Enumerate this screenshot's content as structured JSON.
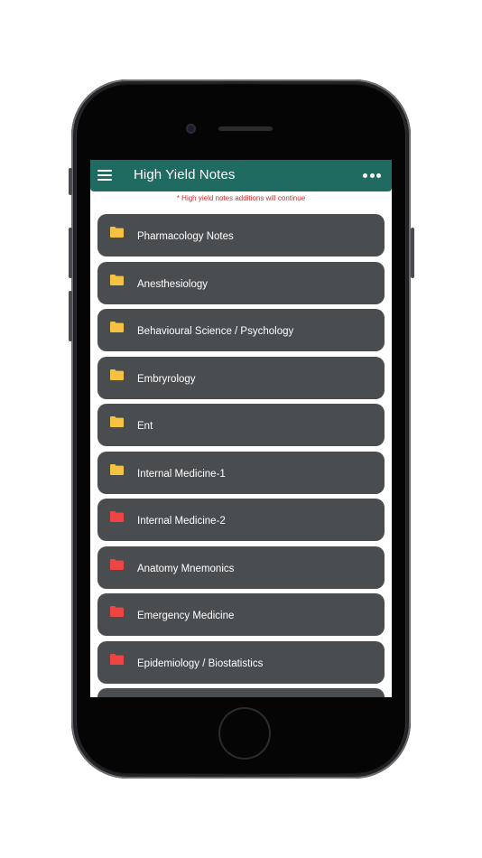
{
  "appbar": {
    "title": "High Yield Notes",
    "menu_icon": "hamburger-menu-icon",
    "more_icon": "more-options-icon",
    "background": "#1f6b62"
  },
  "notice": "* High yield notes additions will continue",
  "colors": {
    "notice": "#d92b2b",
    "item_background": "#4a4d50",
    "folder_yellow": "#f5c242",
    "folder_red": "#ef4444"
  },
  "items": [
    {
      "label": "Pharmacology Notes",
      "icon": "folder-icon",
      "color": "#f5c242"
    },
    {
      "label": "Anesthesiology",
      "icon": "folder-icon",
      "color": "#f5c242"
    },
    {
      "label": "Behavioural Science / Psychology",
      "icon": "folder-icon",
      "color": "#f5c242"
    },
    {
      "label": "Embryrology",
      "icon": "folder-icon",
      "color": "#f5c242"
    },
    {
      "label": "Ent",
      "icon": "folder-icon",
      "color": "#f5c242"
    },
    {
      "label": "Internal Medicine-1",
      "icon": "folder-icon",
      "color": "#f5c242"
    },
    {
      "label": "Internal Medicine-2",
      "icon": "folder-icon",
      "color": "#ef4444"
    },
    {
      "label": "Anatomy Mnemonics",
      "icon": "folder-icon",
      "color": "#ef4444"
    },
    {
      "label": "Emergency Medicine",
      "icon": "folder-icon",
      "color": "#ef4444"
    },
    {
      "label": "Epidemiology / Biostatistics",
      "icon": "folder-icon",
      "color": "#ef4444"
    },
    {
      "label": "",
      "icon": "folder-icon",
      "color": "#ef4444"
    }
  ]
}
